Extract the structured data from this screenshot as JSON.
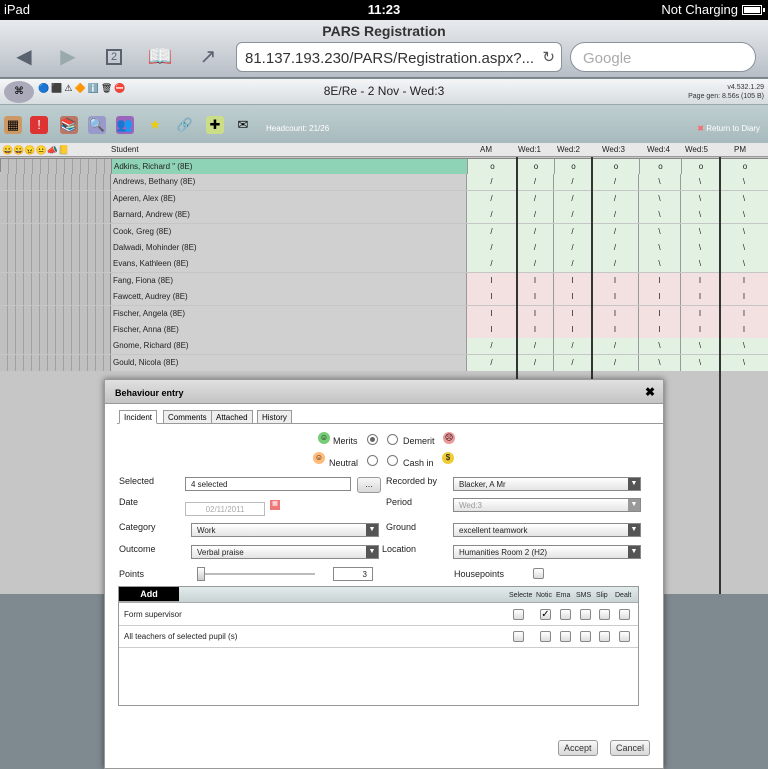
{
  "status_bar": {
    "device": "iPad",
    "time": "11:23",
    "battery": "Not Charging"
  },
  "browser": {
    "title": "PARS Registration",
    "url": "81.137.193.230/PARS/Registration.aspx?...",
    "search_placeholder": "Google",
    "tab_count": "2"
  },
  "app": {
    "title": "8E/Re - 2 Nov - Wed:3",
    "version": "v4.532.1.29",
    "page_gen": "Page gen: 8.56s (105 B)",
    "headcount": "Headcount:  21/26",
    "return": "Return to Diary"
  },
  "grid": {
    "columns": {
      "student": "Student",
      "am": "AM",
      "w1": "Wed:1",
      "w2": "Wed:2",
      "w3": "Wed:3",
      "w4": "Wed:4",
      "w5": "Wed:5",
      "pm": "PM"
    },
    "rows": [
      {
        "name": "Adkins, Richard \" (8E)",
        "marks": [
          "o",
          "o",
          "o",
          "o",
          "o",
          "o",
          "o"
        ],
        "status": "ok"
      },
      {
        "name": "Andrews, Bethany (8E)",
        "marks": [
          "/",
          "/",
          "/",
          "/",
          "\\",
          "\\",
          "\\"
        ],
        "status": "ok"
      },
      {
        "name": "Aperen, Alex (8E)",
        "marks": [
          "/",
          "/",
          "/",
          "/",
          "\\",
          "\\",
          "\\"
        ],
        "status": "ok"
      },
      {
        "name": "Barnard, Andrew (8E)",
        "marks": [
          "/",
          "/",
          "/",
          "/",
          "\\",
          "\\",
          "\\"
        ],
        "status": "ok"
      },
      {
        "name": "Cook, Greg (8E)",
        "marks": [
          "/",
          "/",
          "/",
          "/",
          "\\",
          "\\",
          "\\"
        ],
        "status": "ok"
      },
      {
        "name": "Dalwadi, Mohinder (8E)",
        "marks": [
          "/",
          "/",
          "/",
          "/",
          "\\",
          "\\",
          "\\"
        ],
        "status": "ok"
      },
      {
        "name": "Evans, Kathleen (8E)",
        "marks": [
          "/",
          "/",
          "/",
          "/",
          "\\",
          "\\",
          "\\"
        ],
        "status": "ok"
      },
      {
        "name": "Fang, Fiona (8E)",
        "marks": [
          "I",
          "I",
          "I",
          "I",
          "I",
          "I",
          "I"
        ],
        "status": "bad"
      },
      {
        "name": "Fawcett, Audrey (8E)",
        "marks": [
          "I",
          "I",
          "I",
          "I",
          "I",
          "I",
          "I"
        ],
        "status": "bad"
      },
      {
        "name": "Fischer, Angela (8E)",
        "marks": [
          "I",
          "I",
          "I",
          "I",
          "I",
          "I",
          "I"
        ],
        "status": "bad"
      },
      {
        "name": "Fischer, Anna (8E)",
        "marks": [
          "I",
          "I",
          "I",
          "I",
          "I",
          "I",
          "I"
        ],
        "status": "bad"
      },
      {
        "name": "Gnome, Richard (8E)",
        "marks": [
          "/",
          "/",
          "/",
          "/",
          "\\",
          "\\",
          "\\"
        ],
        "status": "ok"
      },
      {
        "name": "Gould, Nicola (8E)",
        "marks": [
          "/",
          "/",
          "/",
          "/",
          "\\",
          "\\",
          "\\"
        ],
        "status": "ok"
      }
    ]
  },
  "dialog": {
    "title": "Behaviour entry",
    "tabs": [
      "Incident",
      "Comments",
      "Attached",
      "History"
    ],
    "types": {
      "merits": "Merits",
      "demerit": "Demerit",
      "neutral": "Neutral",
      "cash_in": "Cash in"
    },
    "selected_label": "Selected",
    "selected_value": "4 selected",
    "browse": "...",
    "recorded_label": "Recorded by",
    "recorded_value": "Blacker, A Mr",
    "date_label": "Date",
    "date_value": "02/11/2011",
    "period_label": "Period",
    "period_value": "Wed:3",
    "category_label": "Category",
    "category_value": "Work",
    "ground_label": "Ground",
    "ground_value": "excellent teamwork",
    "outcome_label": "Outcome",
    "outcome_value": "Verbal praise",
    "location_label": "Location",
    "location_value": "Humanities Room 2 (H2)",
    "points_label": "Points",
    "points_value": "3",
    "housepoints_label": "Housepoints",
    "notify": {
      "add": "Add",
      "headers": [
        "Selecte",
        "Notic",
        "Ema",
        "SMS",
        "Slip",
        "Dealt"
      ],
      "rows": [
        {
          "label": "Form supervisor",
          "checks": [
            false,
            true,
            false,
            false,
            false,
            false
          ]
        },
        {
          "label": "All teachers of selected pupil (s)",
          "checks": [
            false,
            false,
            false,
            false,
            false,
            false
          ]
        }
      ]
    },
    "accept": "Accept",
    "cancel": "Cancel"
  }
}
